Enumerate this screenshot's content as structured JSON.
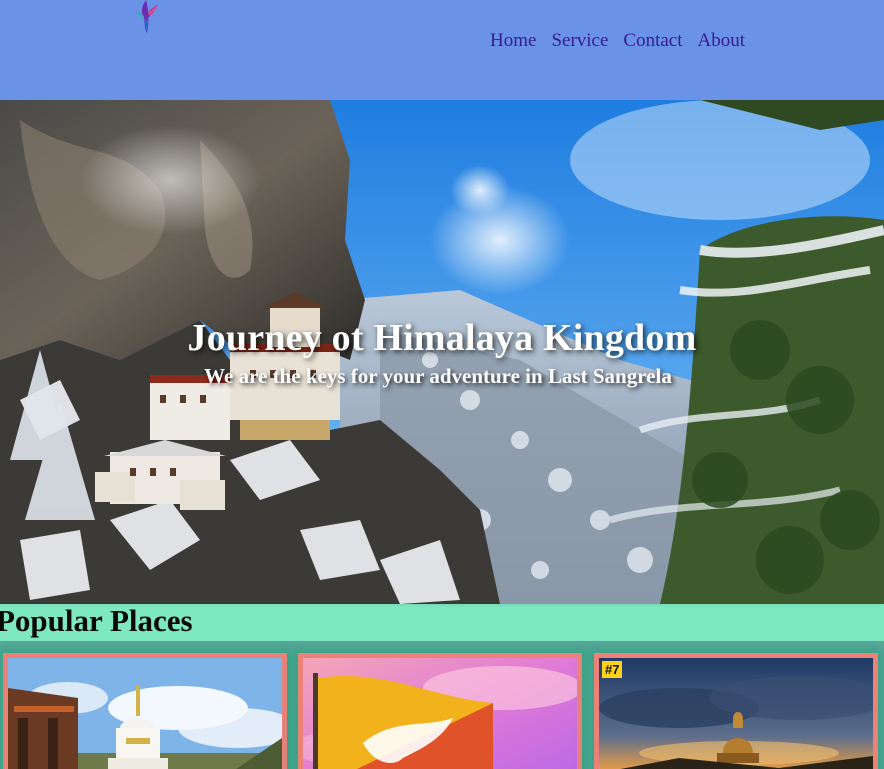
{
  "header": {
    "logo_icon": "hummingbird-logo-icon",
    "background_color": "#6a92e6",
    "nav": [
      {
        "label": "Home"
      },
      {
        "label": "Service"
      },
      {
        "label": "Contact"
      },
      {
        "label": "About"
      }
    ],
    "nav_color": "#3a1b8e"
  },
  "hero": {
    "title": "Journey ot Himalaya Kingdom",
    "subtitle": "We are the keys for your adventure in Last Sangrela",
    "image": "tigers-nest-monastery-snowy-cliff"
  },
  "popular": {
    "heading": "Popular Places",
    "background_color": "#7ee8c2",
    "card_border_color": "#ea8279",
    "cards": [
      {
        "image": "stupa-and-prayer-flags"
      },
      {
        "image": "bhutan-flag"
      },
      {
        "image": "buddha-dordenma-statue",
        "tag": "#7"
      }
    ]
  }
}
